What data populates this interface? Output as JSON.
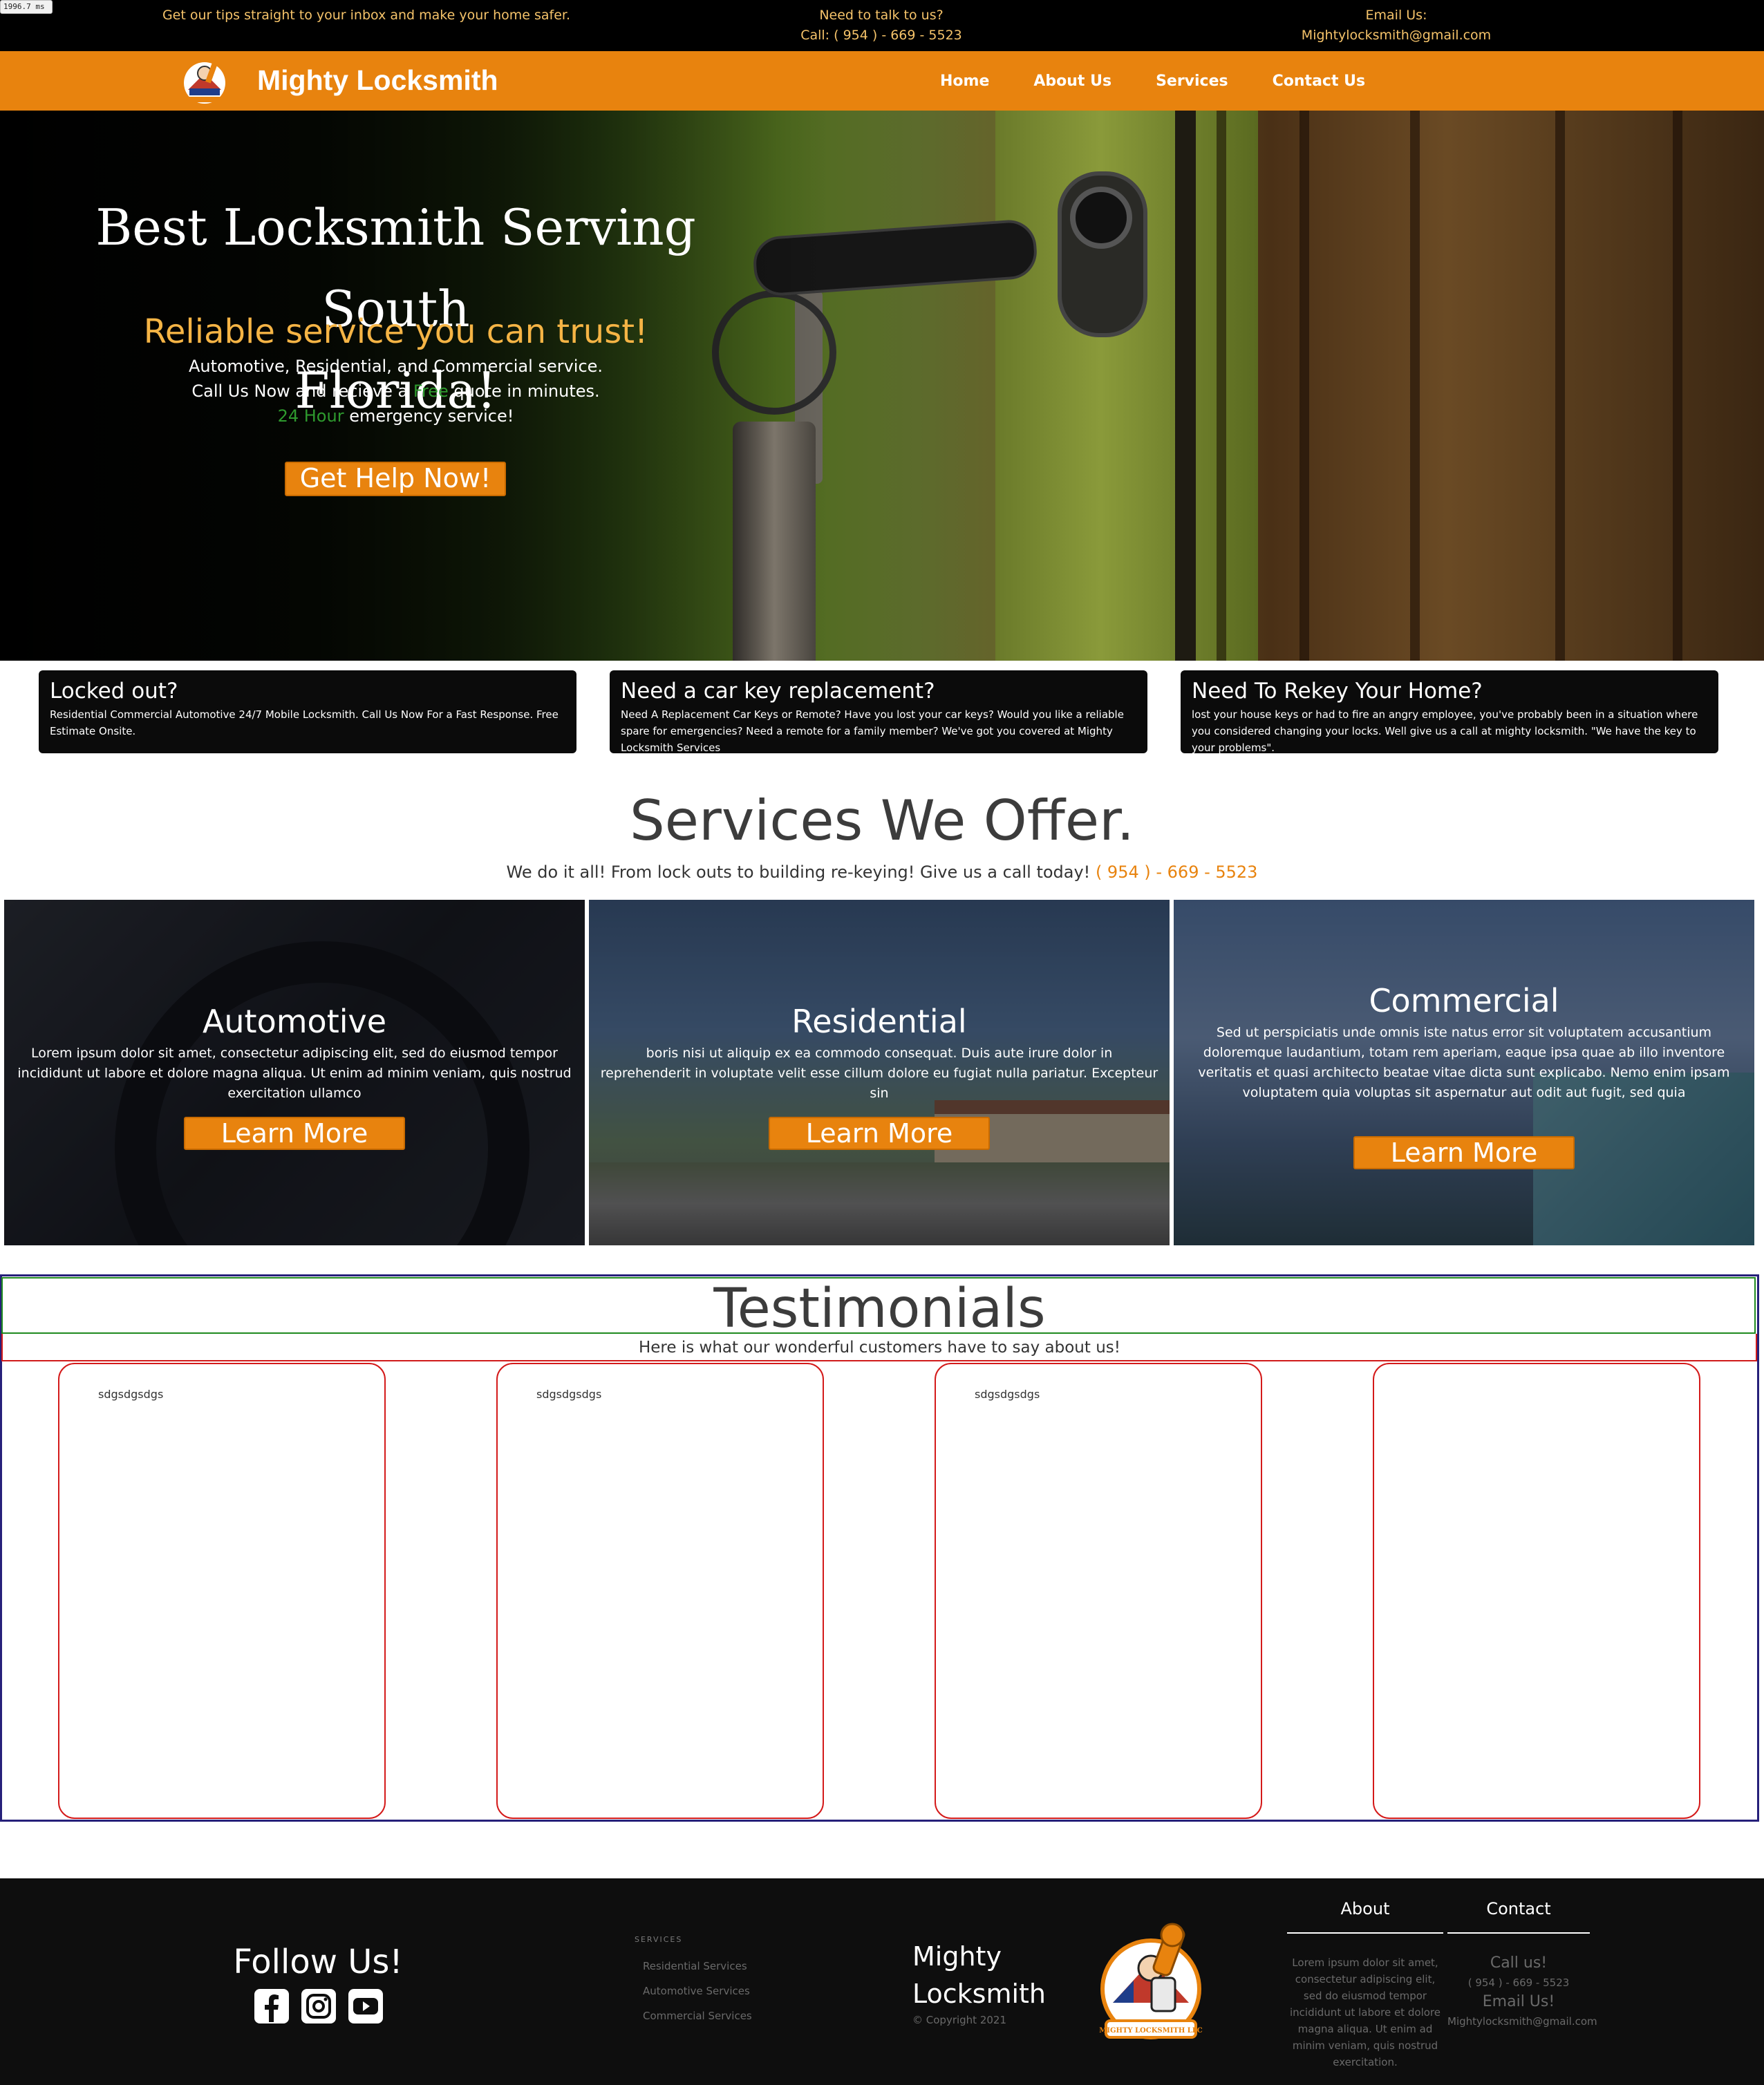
{
  "timer": "1996.7 ms",
  "topbar": {
    "tips": "Get our tips straight to your inbox and make your home safer.",
    "talk_label": "Need to talk to us?",
    "talk_phone": "Call: ( 954 ) - 669 - 5523",
    "email_label": "Email Us:",
    "email": "Mightylocksmith@gmail.com"
  },
  "nav": {
    "brand": "Mighty Locksmith",
    "links": [
      "Home",
      "About Us",
      "Services",
      "Contact Us"
    ]
  },
  "hero": {
    "title_line1": "Best Locksmith Serving South",
    "title_line2": "Florida!",
    "subtitle": "Reliable service you can trust!",
    "line1": "Automotive, Residential, and Commercial service.",
    "line2_pre": "Call Us Now and recieve a ",
    "line2_free": "Free",
    "line2_post": " quote in minutes.",
    "line3_hours": "24 Hour",
    "line3_post": " emergency service!",
    "cta": "Get Help Now!"
  },
  "info_cards": [
    {
      "title": "Locked out?",
      "text": "Residential Commercial Automotive 24/7 Mobile Locksmith. Call Us Now For a Fast Response. Free Estimate Onsite."
    },
    {
      "title": "Need a car key replacement?",
      "text": "Need A Replacement Car Keys or Remote? Have you lost your car keys? Would you like a reliable spare for emergencies? Need a remote for a family member? We've got you covered at Mighty Locksmith Services"
    },
    {
      "title": "Need To Rekey Your Home?",
      "text": "lost your house keys or had to fire an angry employee, you've probably been in a situation where you considered changing your locks. Well give us a call at mighty locksmith. \"We have the key to your problems\"."
    }
  ],
  "services": {
    "title": "Services We Offer.",
    "subtitle_pre": "We do it all! From lock outs to building re-keying! Give us a call today! ",
    "subtitle_phone": "( 954 ) - 669 - 5523",
    "items": [
      {
        "title": "Automotive",
        "text": "Lorem ipsum dolor sit amet, consectetur adipiscing elit, sed do eiusmod tempor incididunt ut labore et dolore magna aliqua. Ut enim ad minim veniam, quis nostrud exercitation ullamco",
        "button": "Learn More"
      },
      {
        "title": "Residential",
        "text": "boris nisi ut aliquip ex ea commodo consequat. Duis aute irure dolor in reprehenderit in voluptate velit esse cillum dolore eu fugiat nulla pariatur. Excepteur sin",
        "button": "Learn More"
      },
      {
        "title": "Commercial",
        "text": "Sed ut perspiciatis unde omnis iste natus error sit voluptatem accusantium doloremque laudantium, totam rem aperiam, eaque ipsa quae ab illo inventore veritatis et quasi architecto beatae vitae dicta sunt explicabo. Nemo enim ipsam voluptatem quia voluptas sit aspernatur aut odit aut fugit, sed quia",
        "button": "Learn More"
      }
    ]
  },
  "testimonials": {
    "title": "Testimonials",
    "subtitle": "Here is what our wonderful customers have to say about us!",
    "cards": [
      "sdgsdgsdgs",
      "sdgsdgsdgs",
      "sdgsdgsdgs",
      ""
    ]
  },
  "footer": {
    "follow": "Follow Us!",
    "social_icons": [
      "facebook-icon",
      "instagram-icon",
      "youtube-icon"
    ],
    "services_heading": "SERVICES",
    "services_links": [
      "Residential Services",
      "Automotive Services",
      "Commercial Services"
    ],
    "brand_line1": "Mighty",
    "brand_line2": "Locksmith",
    "copyright": "© Copyright 2021",
    "logo_text": "MIGHTY LOCKSMITH LLC",
    "about_heading": "About",
    "about_text": "Lorem ipsum dolor sit amet, consectetur adipiscing elit, sed do eiusmod tempor incididunt ut labore et dolore magna aliqua. Ut enim ad minim veniam, quis nostrud exercitation.",
    "contact_heading": "Contact",
    "contact_call": "Call us!",
    "contact_phone": "( 954 ) - 669 - 5523",
    "contact_email_label": "Email Us!",
    "contact_email": "Mightylocksmith@gmail.com"
  },
  "colors": {
    "accent": "#e8830e",
    "topbar_bg": "#000000",
    "topbar_text": "#f5c36a",
    "hero_subtitle": "#f5b445",
    "highlight_green": "#2e9a2e",
    "footer_bg": "#0e0e0e"
  }
}
